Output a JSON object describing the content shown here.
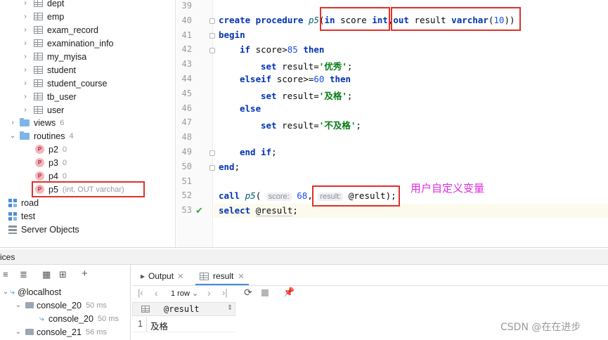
{
  "tree": {
    "tables": [
      "dept",
      "emp",
      "exam_record",
      "examination_info",
      "my_myisa",
      "student",
      "student_course",
      "tb_user",
      "user"
    ],
    "views": {
      "label": "views",
      "count": "6"
    },
    "routines": {
      "label": "routines",
      "count": "4"
    },
    "procs": [
      {
        "name": "p2",
        "sig": "0"
      },
      {
        "name": "p3",
        "sig": "0"
      },
      {
        "name": "p4",
        "sig": "0"
      },
      {
        "name": "p5",
        "sig": "(int, OUT varchar)"
      }
    ],
    "schemas": [
      "road",
      "test"
    ],
    "server_objects": "Server Objects"
  },
  "editor": {
    "line_numbers": [
      "39",
      "40",
      "41",
      "42",
      "43",
      "44",
      "45",
      "46",
      "47",
      "48",
      "49",
      "50",
      "51",
      "52",
      "53"
    ],
    "l40": {
      "kw1": "create procedure ",
      "name": "p5",
      "p1": "(",
      "kw2": "in ",
      "t1": "score ",
      "kw3": "int",
      "c": ",",
      "kw4": "out ",
      "t2": "result ",
      "kw5": "varchar",
      "p2": "(",
      "n": "10",
      "p3": "))"
    },
    "l41": "begin",
    "l42": {
      "kw": "if ",
      "t": "score>",
      "n": "85",
      "kw2": " then"
    },
    "l43": {
      "kw": "set ",
      "t": "result=",
      "s": "'优秀'",
      "e": ";"
    },
    "l44": {
      "kw": "elseif ",
      "t": "score>=",
      "n": "60",
      "kw2": " then"
    },
    "l45": {
      "kw": "set ",
      "t": "result=",
      "s": "'及格'",
      "e": ";"
    },
    "l46": "else",
    "l47": {
      "kw": "set ",
      "t": "result=",
      "s": "'不及格'",
      "e": ";"
    },
    "l49": {
      "kw": "end if",
      "e": ";"
    },
    "l50": {
      "kw": "end",
      "e": ";"
    },
    "l52": {
      "kw": "call ",
      "name": "p5",
      "p1": "( ",
      "hint1": "score:",
      "n": "68",
      "c": ", ",
      "hint2": "result:",
      "v": " @result",
      "e": ");"
    },
    "l53": {
      "kw": "select ",
      "v": "@result",
      "e": ";"
    },
    "annotation": "用户自定义变量"
  },
  "services": {
    "title": "ices",
    "tree": [
      {
        "label": "@localhost"
      },
      {
        "label": "console_20",
        "time": "50 ms"
      },
      {
        "label": "console_20",
        "time": "50 ms"
      },
      {
        "label": "console_21",
        "time": "56 ms"
      }
    ]
  },
  "results": {
    "tabs": [
      "Output",
      "result"
    ],
    "rows_label": "1 row",
    "column": "@result",
    "row_num": "1",
    "value": "及格"
  },
  "watermark": "CSDN @在在进步"
}
